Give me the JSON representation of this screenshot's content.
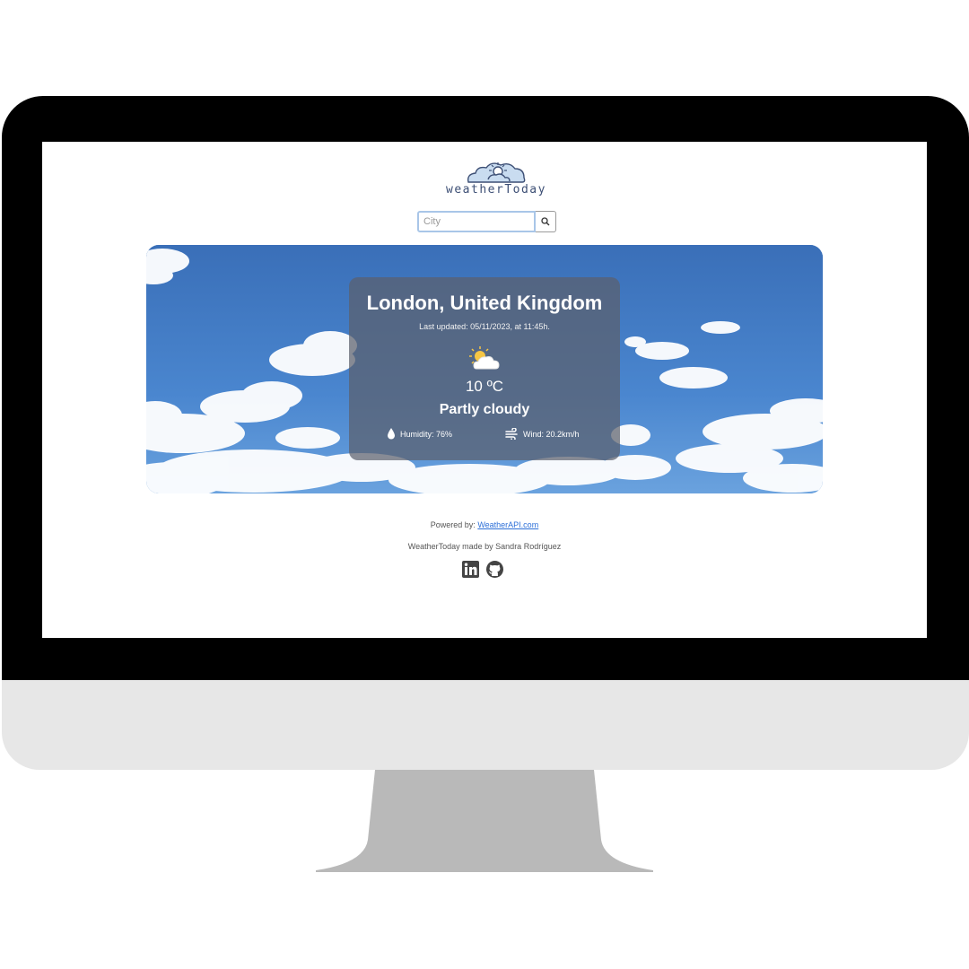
{
  "app": {
    "logo_text": "weatherToday"
  },
  "search": {
    "placeholder": "City",
    "value": "",
    "button_icon": "search-icon"
  },
  "weather": {
    "location": "London, United Kingdom",
    "last_updated": "Last updated: 05/11/2023, at 11:45h.",
    "condition_icon": "partly-cloudy-icon",
    "temperature": "10 ºC",
    "condition": "Partly cloudy",
    "humidity": "Humidity: 76%",
    "wind": "Wind: 20.2km/h"
  },
  "footer": {
    "powered_label": "Powered by:",
    "powered_link": "WeatherAPI.com",
    "made_by": "WeatherToday made by Sandra Rodríguez",
    "social_icons": [
      "linkedin-icon",
      "github-icon"
    ]
  },
  "colors": {
    "accent": "#2c6fd8",
    "sky": "#3f78c0",
    "card": "#5c606c",
    "bezel": "#000000",
    "chin": "#e7e7e7",
    "stand": "#b9b9b9"
  }
}
